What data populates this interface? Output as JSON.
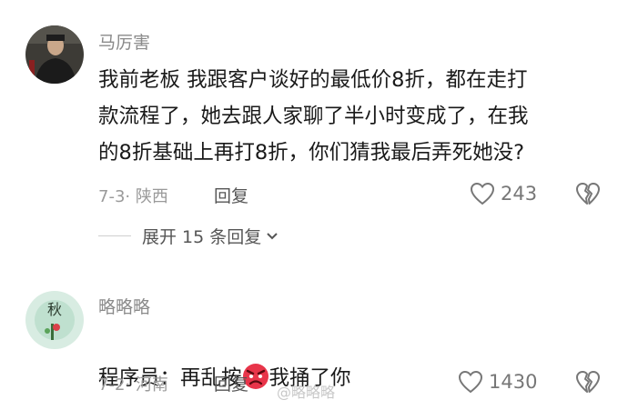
{
  "comments": [
    {
      "username": "马厉害",
      "content": "我前老板 我跟客户谈好的最低价8折，都在走打\n款流程了，她去跟人家聊了半小时变成了，在我\n的8折基础上再打8折，你们猜我最后弄死她没?",
      "date_location": "7-3· 陕西",
      "reply_label": "回复",
      "like_count": "243",
      "like_icon": "heart-outline-icon",
      "dislike_icon": "broken-heart-icon",
      "expand_label": "展开 15 条回复"
    },
    {
      "username": "略略略",
      "content_before": "程序员：再乱按",
      "content_emoji": "angry-face-emoji",
      "content_after": "我捅了你",
      "date_location": "7-2· 河南",
      "reply_label": "回复",
      "like_count": "1430",
      "like_icon": "heart-outline-icon",
      "dislike_icon": "broken-heart-icon"
    }
  ],
  "watermark": "@略略略",
  "colors": {
    "text": "#1a1a1a",
    "username": "#8a8a8a",
    "meta": "#9a9a9a",
    "emoji": "#e8354a"
  }
}
